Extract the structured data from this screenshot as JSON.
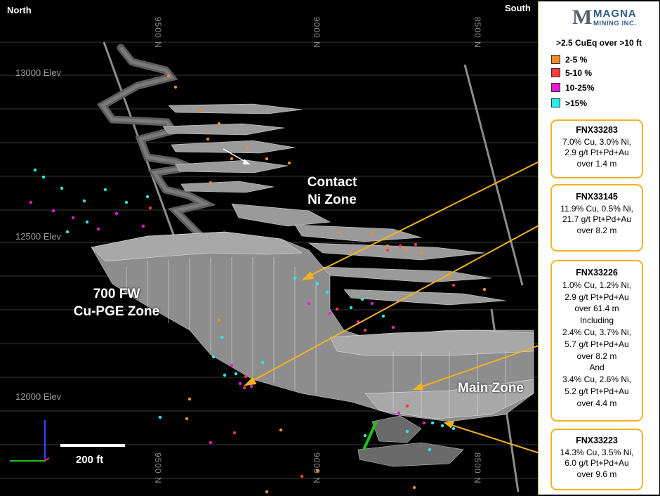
{
  "corners": {
    "left": "North",
    "right": "South"
  },
  "elevations": [
    "13000 Elev",
    "12500 Elev",
    "12000 Elev"
  ],
  "northings": [
    "9500 N",
    "9000 N",
    "8500 N",
    "9500 N",
    "9000 N",
    "8500 N"
  ],
  "zones": {
    "contact": [
      "Contact",
      "Ni Zone"
    ],
    "fw": [
      "700 FW",
      "Cu-PGE Zone"
    ],
    "main": "Main Zone"
  },
  "scale": "200 ft",
  "legend": {
    "logo_top": "MAGNA",
    "logo_bottom": "MINING INC.",
    "title": ">2.5 CuEq over >10 ft",
    "items": [
      {
        "label": "2-5 %",
        "color": "#f28c28"
      },
      {
        "label": "5-10 %",
        "color": "#ff3a3a"
      },
      {
        "label": "10-25%",
        "color": "#e81bd8"
      },
      {
        "label": ">15%",
        "color": "#1ff0ee"
      }
    ]
  },
  "accent_color": "#f2b221",
  "cards": [
    {
      "hole": "FNX33283",
      "lines": [
        "7.0% Cu, 3.0% Ni,",
        "2.9 g/t Pt+Pd+Au",
        "over 1.4 m"
      ]
    },
    {
      "hole": "FNX33145",
      "lines": [
        "11.9% Cu, 0.5% Ni,",
        "21.7 g/t Pt+Pd+Au",
        "over 8.2 m"
      ]
    },
    {
      "hole": "FNX33226",
      "lines": [
        "1.0% Cu, 1.2% Ni,",
        "2.9 g/t Pt+Pd+Au",
        "over 61.4 m",
        "Including",
        "2.4% Cu, 3.7% Ni,",
        "5.7 g/t Pt+Pd+Au",
        "over 8.2 m",
        "And",
        "3.4% Cu, 2.6% Ni,",
        "5.2 g/t Pt+Pd+Au",
        "over 4.4 m"
      ]
    },
    {
      "hole": "FNX33223",
      "lines": [
        "14.3% Cu, 3.5% Ni,",
        "6.0 g/t Pt+Pd+Au",
        "over 9.6 m"
      ]
    }
  ]
}
